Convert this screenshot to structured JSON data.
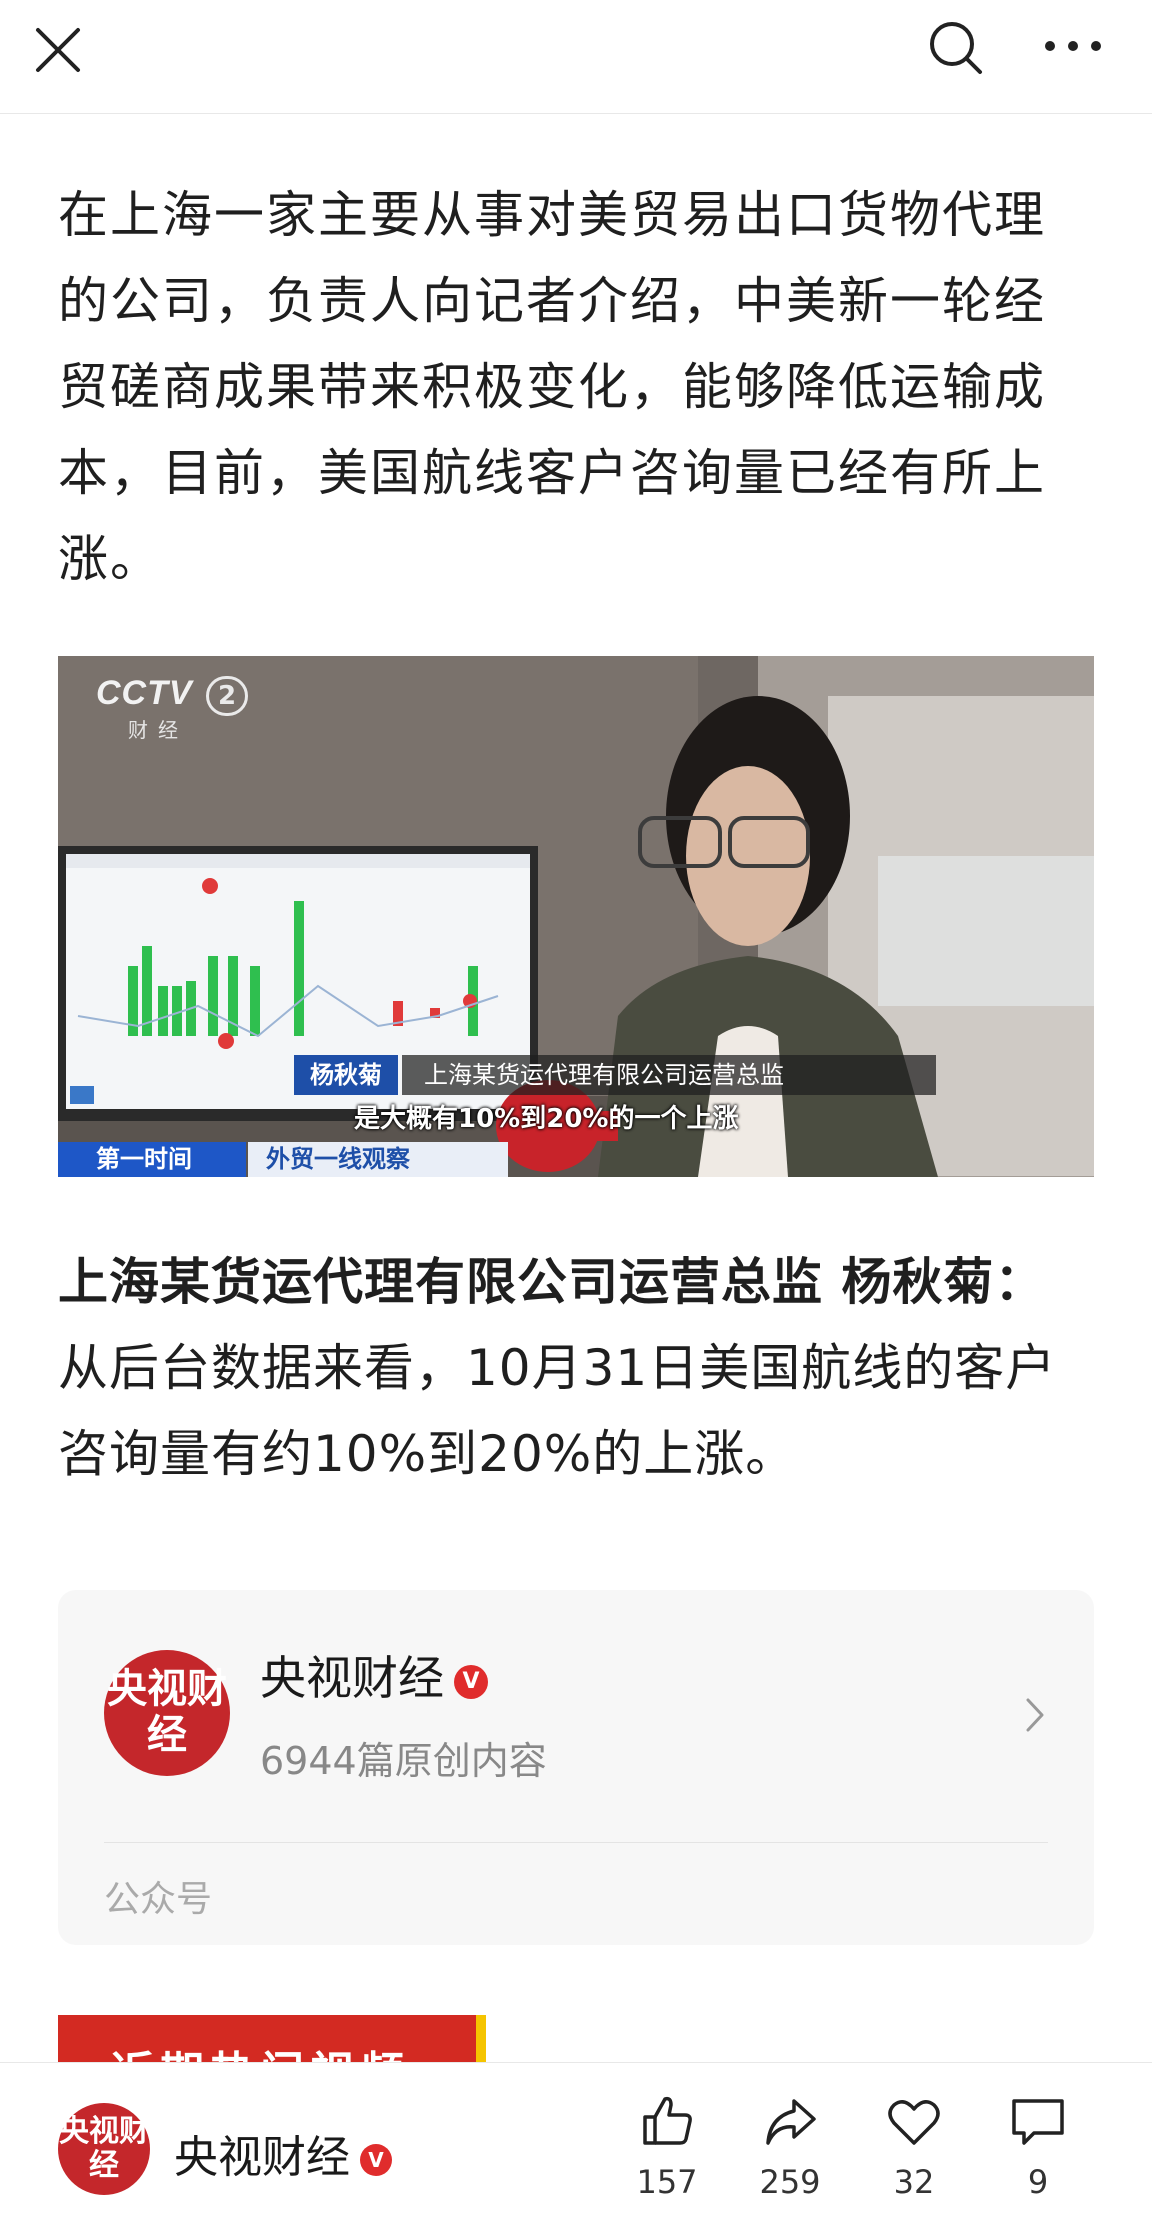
{
  "topbar": {
    "close_icon": "close-icon",
    "search_icon": "search-icon",
    "more_icon": "more-icon"
  },
  "article": {
    "paragraph": "在上海一家主要从事对美贸易出口货物代理的公司，负责人向记者介绍，中美新一轮经贸磋商成果带来积极变化，能够降低运输成本，目前，美国航线客户咨询量已经有所上涨。",
    "video": {
      "logo": "CCTV",
      "channel": "2",
      "logo_sub": "财经",
      "name_tag": "杨秋菊",
      "title_tag": "上海某货运代理有限公司运营总监",
      "subtitle": "是大概有10%到20%的一个上涨",
      "tag_program": "第一时间",
      "tag_column": "外贸一线观察"
    },
    "quote_speaker": "上海某货运代理有限公司运营总监 杨秋菊：",
    "quote_text": "从后台数据来看，10月31日美国航线的客户咨询量有约10%到20%的上涨。"
  },
  "account_card": {
    "avatar_text": "央视财经",
    "name": "央视财经",
    "verified": "V",
    "count": "6944篇原创内容",
    "type": "公众号"
  },
  "banner": {
    "text": "近期热门视频"
  },
  "bottombar": {
    "avatar_text": "央视财经",
    "name": "央视财经",
    "verified": "V",
    "like_count": "157",
    "share_count": "259",
    "favorite_count": "32",
    "comment_count": "9"
  },
  "colors": {
    "brand_red": "#c4272b",
    "cctv_blue": "#1e4fa8"
  }
}
